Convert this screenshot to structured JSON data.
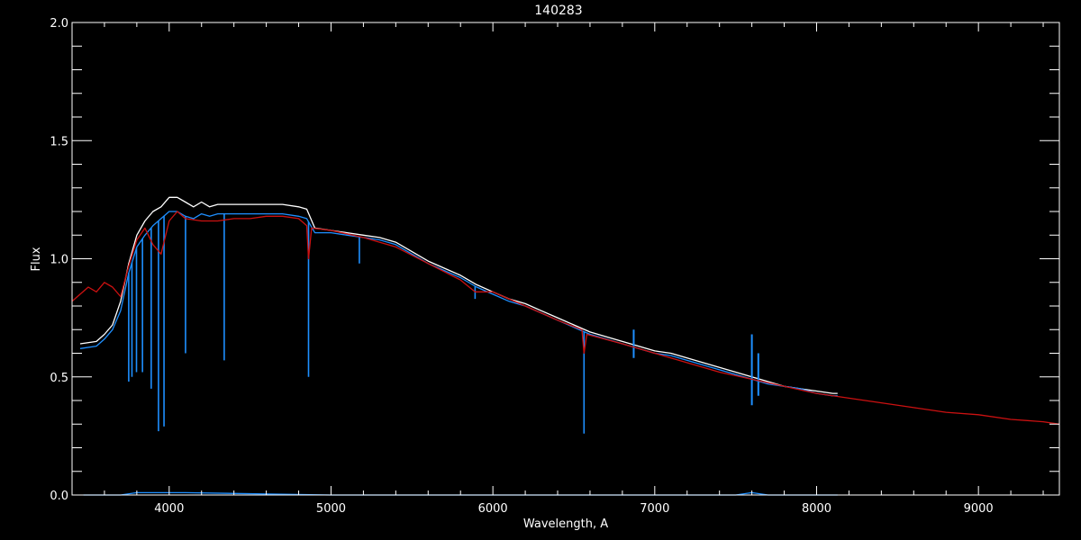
{
  "chart_data": {
    "type": "line",
    "title": "140283",
    "xlabel": "Wavelength, A",
    "ylabel": "Flux",
    "xlim": [
      3400,
      9500
    ],
    "ylim": [
      0.0,
      2.0
    ],
    "x_ticks": [
      4000,
      5000,
      6000,
      7000,
      8000,
      9000
    ],
    "x_tick_labels": [
      "4000",
      "5000",
      "6000",
      "7000",
      "8000",
      "9000"
    ],
    "y_ticks": [
      0.0,
      0.5,
      1.0,
      1.5,
      2.0
    ],
    "y_tick_labels": [
      "0.0",
      "0.5",
      "1.0",
      "1.5",
      "2.0"
    ],
    "grid": false,
    "background": "#000000",
    "series": [
      {
        "key": "observed-white",
        "color": "#ffffff",
        "x": [
          3450,
          3550,
          3600,
          3650,
          3700,
          3750,
          3800,
          3850,
          3900,
          3950,
          4000,
          4050,
          4100,
          4150,
          4200,
          4250,
          4300,
          4400,
          4500,
          4600,
          4700,
          4800,
          4850,
          4900,
          5000,
          5100,
          5200,
          5300,
          5400,
          5500,
          5600,
          5700,
          5800,
          5900,
          6000,
          6100,
          6200,
          6300,
          6400,
          6500,
          6600,
          6700,
          6800,
          6900,
          7000,
          7100,
          7200,
          7300,
          7400,
          7500,
          7600,
          7700,
          7800,
          7900,
          8000,
          8100,
          8130
        ],
        "y": [
          0.64,
          0.65,
          0.68,
          0.72,
          0.82,
          0.98,
          1.1,
          1.16,
          1.2,
          1.22,
          1.26,
          1.26,
          1.24,
          1.22,
          1.24,
          1.22,
          1.23,
          1.23,
          1.23,
          1.23,
          1.23,
          1.22,
          1.21,
          1.13,
          1.12,
          1.11,
          1.1,
          1.09,
          1.07,
          1.03,
          0.99,
          0.96,
          0.93,
          0.89,
          0.86,
          0.83,
          0.81,
          0.78,
          0.75,
          0.72,
          0.69,
          0.67,
          0.65,
          0.63,
          0.61,
          0.6,
          0.58,
          0.56,
          0.54,
          0.52,
          0.5,
          0.48,
          0.46,
          0.45,
          0.44,
          0.43,
          0.43
        ]
      },
      {
        "key": "observed-blue",
        "color": "#1e8fff",
        "x": [
          3450,
          3550,
          3600,
          3650,
          3700,
          3750,
          3800,
          3850,
          3900,
          3950,
          4000,
          4050,
          4100,
          4150,
          4200,
          4250,
          4300,
          4400,
          4500,
          4600,
          4700,
          4800,
          4850,
          4900,
          5000,
          5100,
          5200,
          5300,
          5400,
          5500,
          5600,
          5700,
          5800,
          5900,
          6000,
          6100,
          6200,
          6300,
          6400,
          6500,
          6600,
          6700,
          6800,
          6900,
          7000,
          7100,
          7200,
          7300,
          7400,
          7500,
          7600,
          7700,
          7800,
          7900,
          8000,
          8100,
          8130
        ],
        "y": [
          0.62,
          0.63,
          0.66,
          0.7,
          0.78,
          0.94,
          1.05,
          1.1,
          1.14,
          1.17,
          1.2,
          1.2,
          1.18,
          1.17,
          1.19,
          1.18,
          1.19,
          1.19,
          1.19,
          1.19,
          1.19,
          1.18,
          1.17,
          1.11,
          1.11,
          1.1,
          1.09,
          1.08,
          1.06,
          1.02,
          0.98,
          0.95,
          0.92,
          0.88,
          0.85,
          0.82,
          0.8,
          0.77,
          0.74,
          0.71,
          0.68,
          0.66,
          0.64,
          0.62,
          0.6,
          0.59,
          0.57,
          0.55,
          0.53,
          0.51,
          0.49,
          0.47,
          0.46,
          0.45,
          0.43,
          0.42,
          0.42
        ],
        "absorption_lines": [
          {
            "x": 3750,
            "y": 0.48
          },
          {
            "x": 3770,
            "y": 0.5
          },
          {
            "x": 3798,
            "y": 0.52
          },
          {
            "x": 3835,
            "y": 0.52
          },
          {
            "x": 3889,
            "y": 0.45
          },
          {
            "x": 3934,
            "y": 0.27
          },
          {
            "x": 3968,
            "y": 0.29
          },
          {
            "x": 4101,
            "y": 0.6
          },
          {
            "x": 4340,
            "y": 0.57
          },
          {
            "x": 4861,
            "y": 0.5
          },
          {
            "x": 5175,
            "y": 0.98
          },
          {
            "x": 5890,
            "y": 0.83
          },
          {
            "x": 6563,
            "y": 0.26
          }
        ],
        "telluric_noise": [
          {
            "x": 6870,
            "y_min": 0.58,
            "y_max": 0.7
          },
          {
            "x": 7600,
            "y_min": 0.38,
            "y_max": 0.68
          },
          {
            "x": 7640,
            "y_min": 0.42,
            "y_max": 0.6
          }
        ]
      },
      {
        "key": "model-red",
        "color": "#cc1111",
        "x": [
          3400,
          3450,
          3500,
          3550,
          3600,
          3650,
          3700,
          3750,
          3800,
          3850,
          3900,
          3950,
          4000,
          4050,
          4100,
          4200,
          4300,
          4400,
          4500,
          4600,
          4700,
          4800,
          4850,
          4861,
          4880,
          5000,
          5200,
          5400,
          5600,
          5800,
          5890,
          6000,
          6200,
          6400,
          6550,
          6563,
          6580,
          6800,
          7000,
          7200,
          7400,
          7600,
          7800,
          8000,
          8200,
          8400,
          8600,
          8800,
          9000,
          9200,
          9400,
          9500
        ],
        "y": [
          0.82,
          0.85,
          0.88,
          0.86,
          0.9,
          0.88,
          0.84,
          0.97,
          1.08,
          1.13,
          1.06,
          1.02,
          1.16,
          1.2,
          1.17,
          1.16,
          1.16,
          1.17,
          1.17,
          1.18,
          1.18,
          1.17,
          1.14,
          1.0,
          1.13,
          1.12,
          1.09,
          1.05,
          0.98,
          0.91,
          0.86,
          0.86,
          0.8,
          0.74,
          0.7,
          0.6,
          0.68,
          0.64,
          0.6,
          0.56,
          0.52,
          0.49,
          0.46,
          0.43,
          0.41,
          0.39,
          0.37,
          0.35,
          0.34,
          0.32,
          0.31,
          0.3
        ]
      },
      {
        "key": "error-floor",
        "color": "#1e8fff",
        "x": [
          3470,
          3700,
          3800,
          3900,
          4000,
          4100,
          5000,
          6000,
          7000,
          7500,
          7600,
          7700,
          8000,
          8130
        ],
        "y": [
          0.0,
          0.0,
          0.01,
          0.01,
          0.01,
          0.01,
          0.0,
          0.0,
          0.0,
          0.0,
          0.01,
          0.0,
          0.0,
          0.0
        ]
      }
    ]
  }
}
